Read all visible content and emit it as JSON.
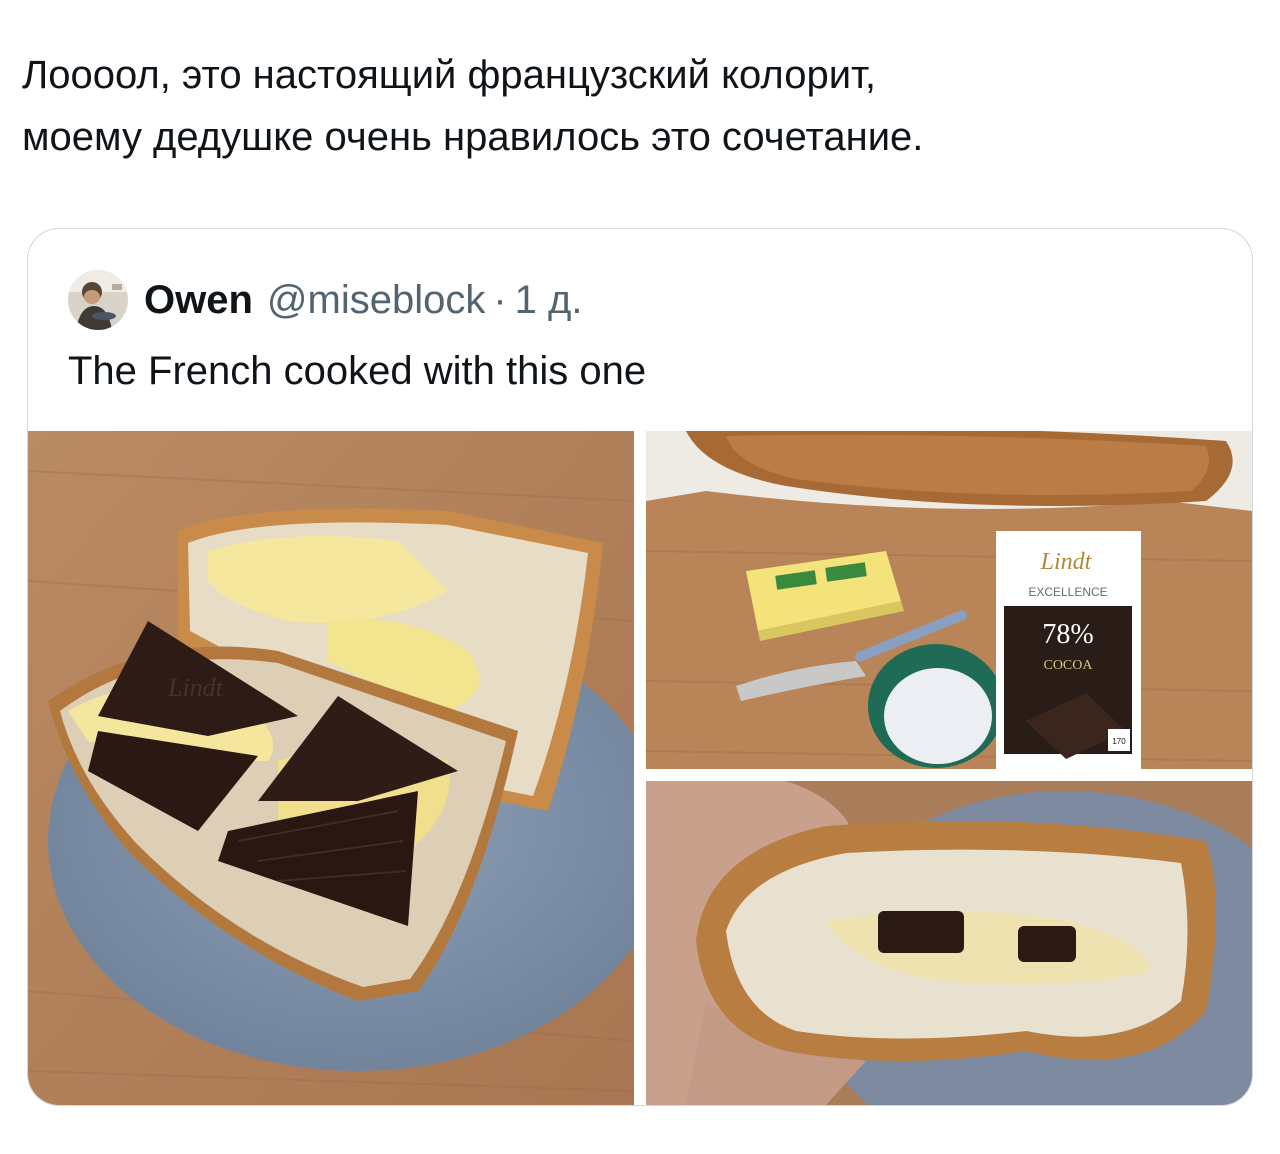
{
  "post": {
    "text_line1": "Лоооол, это настоящий французский колорит,",
    "text_line2": "моему дедушке очень нравилось это сочетание."
  },
  "quoted": {
    "author_name": "Owen",
    "author_handle": "@miseblock",
    "separator": "·",
    "time": "1 д.",
    "text": "The French cooked with this one"
  },
  "photos": {
    "chocolate_brand": "Lindt",
    "chocolate_line": "EXCELLENCE",
    "cocoa_percent": "78%",
    "cocoa_label": "COCOA",
    "calories": "170"
  },
  "colors": {
    "text_primary": "#0f1419",
    "text_secondary": "#536471",
    "card_border": "#cfd9de"
  }
}
